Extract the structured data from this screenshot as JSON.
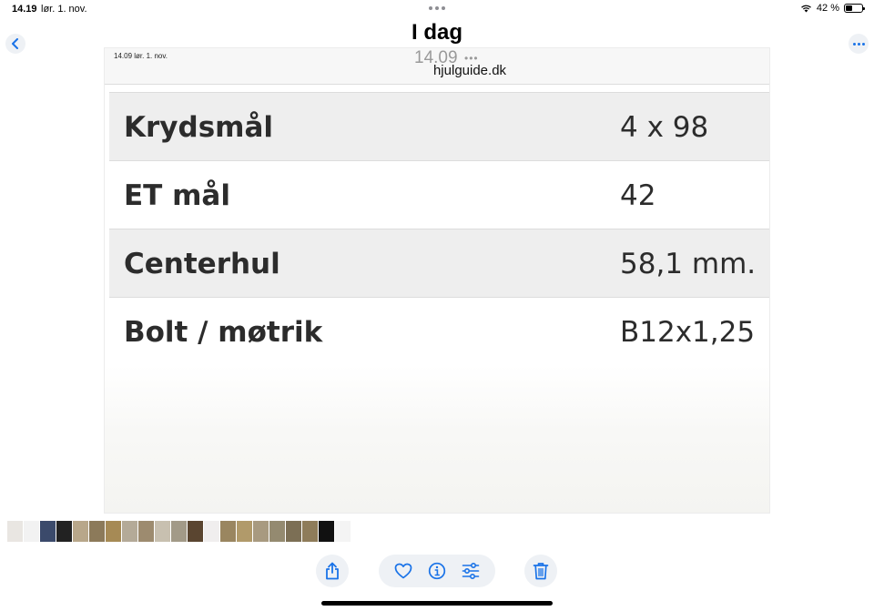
{
  "status_bar": {
    "time": "14.19",
    "date": "lør. 1. nov.",
    "battery_text": "42 %",
    "battery_level": 0.42
  },
  "nav": {
    "title": "I dag"
  },
  "photo": {
    "screenshot_time": "14.09  lør. 1. nov.",
    "ghost_time": "14.09",
    "url": "hjulguide.dk",
    "rows": [
      {
        "label": "Krydsmål",
        "value": "4 x 98"
      },
      {
        "label": "ET mål",
        "value": "42"
      },
      {
        "label": "Centerhul",
        "value": "58,1 mm."
      },
      {
        "label": "Bolt / møtrik",
        "value": "B12x1,25"
      }
    ]
  },
  "filmstrip": {
    "thumb_colors": [
      "#e9e6e2",
      "#f2f2f2",
      "#3b4a6b",
      "#222222",
      "#b8a78a",
      "#8c7a5a",
      "#a68a55",
      "#b4aa98",
      "#9d8b6f",
      "#c8c0b0",
      "#a29a88",
      "#5a4530",
      "#f0eeee",
      "#9a8660",
      "#b19a6a",
      "#a89a80",
      "#948a70",
      "#7c6f55",
      "#8e7c5a",
      "#111111",
      "#f4f4f4"
    ],
    "active_index": 21
  },
  "colors": {
    "accent": "#1a73e8",
    "button_bg": "#eef1f5"
  }
}
